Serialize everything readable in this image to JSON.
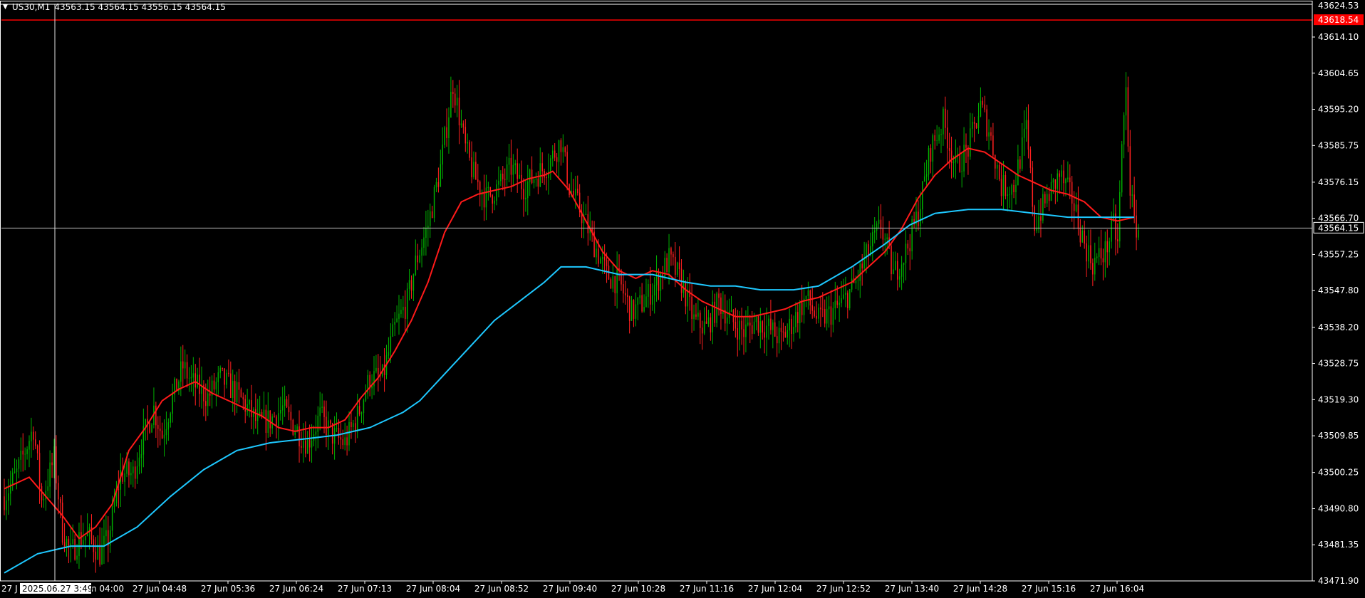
{
  "header": {
    "symbol": "US30,M1",
    "ohlc": "43563.15 43564.15 43556.15 43564.15",
    "menu_icon": "triangle-down-icon"
  },
  "colors": {
    "background": "#000000",
    "bull_candle": "#00b000",
    "bear_candle": "#ff2020",
    "fast_ma": "#ff1a1a",
    "slow_ma": "#1ec8ff",
    "axis_text": "#ffffff",
    "alert_line": "#ff0000",
    "bid_line": "#b8b8b8"
  },
  "crosshair": {
    "time_label": "2025.06.27 3:49",
    "left_clip_label": "27 J",
    "after_label": "n 04:00"
  },
  "chart_data": {
    "type": "candlestick",
    "symbol": "US30",
    "timeframe": "M1",
    "y_ticks": [
      "43614.10",
      "43604.65",
      "43595.20",
      "43585.75",
      "43576.15",
      "43566.70",
      "43557.25",
      "43547.80",
      "43538.20",
      "43528.75",
      "43519.30",
      "43509.85",
      "43500.25",
      "43490.80",
      "43481.35",
      "43471.90"
    ],
    "top_price_label": "43624.53",
    "x_ticks": [
      "27 Jun 04:48",
      "27 Jun 05:36",
      "27 Jun 06:24",
      "27 Jun 07:13",
      "27 Jun 08:04",
      "27 Jun 08:52",
      "27 Jun 09:40",
      "27 Jun 10:28",
      "27 Jun 11:16",
      "27 Jun 12:04",
      "27 Jun 12:52",
      "27 Jun 13:40",
      "27 Jun 14:28",
      "27 Jun 15:16",
      "27 Jun 16:04"
    ],
    "ylim": [
      43470,
      43625
    ],
    "current_price": {
      "label": "43564.15",
      "value": 43564.15
    },
    "alert_line": {
      "label": "43618.54",
      "value": 43618.54
    },
    "grid": false,
    "price_path": [
      [
        0,
        43494
      ],
      [
        3,
        43500
      ],
      [
        7,
        43512
      ],
      [
        9,
        43493
      ],
      [
        12,
        43504
      ],
      [
        14,
        43485
      ],
      [
        16,
        43479
      ],
      [
        18,
        43483
      ],
      [
        20,
        43484
      ],
      [
        23,
        43479
      ],
      [
        25,
        43483
      ],
      [
        28,
        43500
      ],
      [
        31,
        43500
      ],
      [
        33,
        43508
      ],
      [
        36,
        43517
      ],
      [
        38,
        43510
      ],
      [
        40,
        43518
      ],
      [
        43,
        43528
      ],
      [
        45,
        43524
      ],
      [
        49,
        43520
      ],
      [
        52,
        43525
      ],
      [
        55,
        43522
      ],
      [
        58,
        43518
      ],
      [
        61,
        43513
      ],
      [
        64,
        43514
      ],
      [
        67,
        43517
      ],
      [
        70,
        43512
      ],
      [
        73,
        43508
      ],
      [
        76,
        43515
      ],
      [
        79,
        43510
      ],
      [
        82,
        43508
      ],
      [
        85,
        43515
      ],
      [
        88,
        43525
      ],
      [
        91,
        43525
      ],
      [
        94,
        43538
      ],
      [
        97,
        43545
      ],
      [
        99,
        43555
      ],
      [
        102,
        43565
      ],
      [
        105,
        43580
      ],
      [
        108,
        43602
      ],
      [
        111,
        43585
      ],
      [
        113,
        43578
      ],
      [
        116,
        43572
      ],
      [
        119,
        43575
      ],
      [
        122,
        43580
      ],
      [
        125,
        43575
      ],
      [
        128,
        43578
      ],
      [
        131,
        43581
      ],
      [
        134,
        43587
      ],
      [
        136,
        43575
      ],
      [
        139,
        43568
      ],
      [
        142,
        43560
      ],
      [
        145,
        43552
      ],
      [
        148,
        43550
      ],
      [
        151,
        43542
      ],
      [
        154,
        43545
      ],
      [
        157,
        43550
      ],
      [
        160,
        43556
      ],
      [
        163,
        43550
      ],
      [
        166,
        43540
      ],
      [
        169,
        43538
      ],
      [
        172,
        43545
      ],
      [
        175,
        43540
      ],
      [
        178,
        43537
      ],
      [
        181,
        43540
      ],
      [
        184,
        43538
      ],
      [
        187,
        43535
      ],
      [
        190,
        43540
      ],
      [
        193,
        43546
      ],
      [
        196,
        43540
      ],
      [
        199,
        43542
      ],
      [
        202,
        43545
      ],
      [
        205,
        43550
      ],
      [
        208,
        43558
      ],
      [
        211,
        43565
      ],
      [
        214,
        43552
      ],
      [
        217,
        43558
      ],
      [
        220,
        43568
      ],
      [
        223,
        43585
      ],
      [
        226,
        43592
      ],
      [
        229,
        43580
      ],
      [
        232,
        43585
      ],
      [
        235,
        43596
      ],
      [
        237,
        43590
      ],
      [
        240,
        43575
      ],
      [
        243,
        43575
      ],
      [
        246,
        43590
      ],
      [
        248,
        43565
      ],
      [
        251,
        43572
      ],
      [
        254,
        43578
      ],
      [
        257,
        43572
      ],
      [
        260,
        43560
      ],
      [
        262,
        43555
      ],
      [
        265,
        43558
      ],
      [
        267,
        43565
      ],
      [
        268,
        43560
      ],
      [
        269,
        43585
      ],
      [
        270,
        43600
      ],
      [
        271,
        43575
      ],
      [
        272,
        43565
      ],
      [
        273,
        43564
      ]
    ],
    "series": [
      {
        "values": [
          [
            0,
            43496
          ],
          [
            6,
            43499
          ],
          [
            10,
            43494
          ],
          [
            14,
            43489
          ],
          [
            18,
            43483
          ],
          [
            22,
            43486
          ],
          [
            26,
            43492
          ],
          [
            30,
            43506
          ],
          [
            34,
            43512
          ],
          [
            38,
            43519
          ],
          [
            42,
            43522
          ],
          [
            46,
            43524
          ],
          [
            50,
            43521
          ],
          [
            54,
            43519
          ],
          [
            58,
            43517
          ],
          [
            62,
            43515
          ],
          [
            66,
            43512
          ],
          [
            70,
            43511
          ],
          [
            74,
            43512
          ],
          [
            78,
            43512
          ],
          [
            82,
            43514
          ],
          [
            86,
            43520
          ],
          [
            90,
            43525
          ],
          [
            94,
            43532
          ],
          [
            98,
            43540
          ],
          [
            102,
            43550
          ],
          [
            106,
            43563
          ],
          [
            110,
            43571
          ],
          [
            114,
            43573
          ],
          [
            118,
            43574
          ],
          [
            122,
            43575
          ],
          [
            126,
            43577
          ],
          [
            130,
            43578
          ],
          [
            132,
            43579
          ],
          [
            136,
            43574
          ],
          [
            140,
            43566
          ],
          [
            144,
            43558
          ],
          [
            148,
            43553
          ],
          [
            152,
            43551
          ],
          [
            156,
            43553
          ],
          [
            160,
            43552
          ],
          [
            164,
            43548
          ],
          [
            168,
            43545
          ],
          [
            172,
            43543
          ],
          [
            176,
            43541
          ],
          [
            180,
            43541
          ],
          [
            184,
            43542
          ],
          [
            188,
            43543
          ],
          [
            192,
            43545
          ],
          [
            196,
            43546
          ],
          [
            200,
            43548
          ],
          [
            204,
            43550
          ],
          [
            208,
            43554
          ],
          [
            212,
            43558
          ],
          [
            216,
            43564
          ],
          [
            220,
            43572
          ],
          [
            224,
            43578
          ],
          [
            228,
            43582
          ],
          [
            232,
            43585
          ],
          [
            236,
            43584
          ],
          [
            240,
            43581
          ],
          [
            244,
            43578
          ],
          [
            248,
            43576
          ],
          [
            252,
            43574
          ],
          [
            256,
            43573
          ],
          [
            260,
            43571
          ],
          [
            264,
            43567
          ],
          [
            268,
            43566
          ],
          [
            272,
            43567
          ]
        ]
      },
      {
        "values": [
          [
            0,
            43474
          ],
          [
            8,
            43479
          ],
          [
            16,
            43481
          ],
          [
            24,
            43481
          ],
          [
            32,
            43486
          ],
          [
            40,
            43494
          ],
          [
            48,
            43501
          ],
          [
            56,
            43506
          ],
          [
            64,
            43508
          ],
          [
            72,
            43509
          ],
          [
            80,
            43510
          ],
          [
            88,
            43512
          ],
          [
            96,
            43516
          ],
          [
            100,
            43519
          ],
          [
            106,
            43526
          ],
          [
            112,
            43533
          ],
          [
            118,
            43540
          ],
          [
            124,
            43545
          ],
          [
            130,
            43550
          ],
          [
            134,
            43554
          ],
          [
            140,
            43554
          ],
          [
            148,
            43552
          ],
          [
            156,
            43552
          ],
          [
            164,
            43550
          ],
          [
            170,
            43549
          ],
          [
            176,
            43549
          ],
          [
            182,
            43548
          ],
          [
            190,
            43548
          ],
          [
            196,
            43549
          ],
          [
            204,
            43554
          ],
          [
            212,
            43560
          ],
          [
            218,
            43565
          ],
          [
            224,
            43568
          ],
          [
            232,
            43569
          ],
          [
            240,
            43569
          ],
          [
            248,
            43568
          ],
          [
            256,
            43567
          ],
          [
            264,
            43567
          ],
          [
            272,
            43567
          ]
        ]
      }
    ]
  }
}
